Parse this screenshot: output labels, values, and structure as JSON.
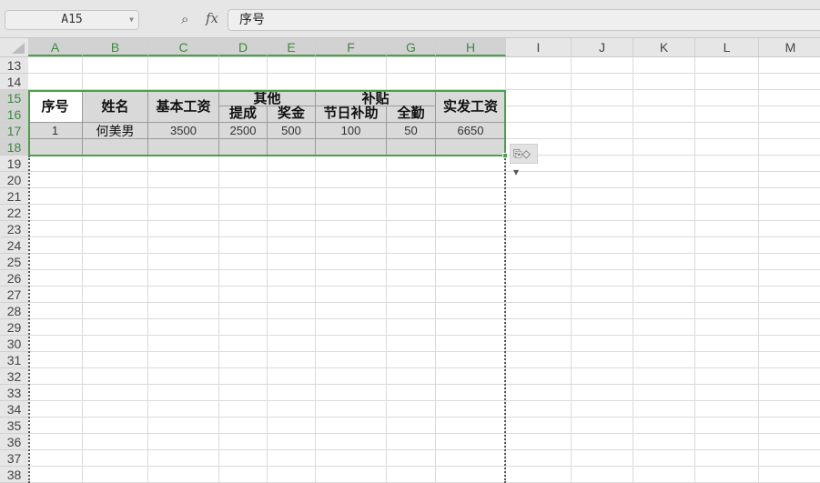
{
  "formula_bar": {
    "name_box": "A15",
    "formula": "序号",
    "fx_label": "fx"
  },
  "columns": [
    "A",
    "B",
    "C",
    "D",
    "E",
    "F",
    "G",
    "H",
    "I",
    "J",
    "K",
    "L",
    "M"
  ],
  "selected_columns": [
    "A",
    "B",
    "C",
    "D",
    "E",
    "F",
    "G",
    "H"
  ],
  "rows": [
    "13",
    "14",
    "15",
    "16",
    "17",
    "18",
    "19",
    "20",
    "21",
    "22",
    "23",
    "24",
    "25",
    "26",
    "27",
    "28",
    "29",
    "30",
    "31",
    "32",
    "33",
    "34",
    "35",
    "36",
    "37",
    "38"
  ],
  "selected_rows": [
    "15",
    "16",
    "17",
    "18"
  ],
  "table": {
    "h_seq": "序号",
    "h_name": "姓名",
    "h_base": "基本工资",
    "h_other": "其他",
    "h_commission": "提成",
    "h_bonus": "奖金",
    "h_allowance": "补贴",
    "h_holiday": "节日补助",
    "h_attendance": "全勤",
    "h_net": "实发工资",
    "row": {
      "seq": "1",
      "name": "何美男",
      "base": "3500",
      "commission": "2500",
      "bonus": "500",
      "holiday": "100",
      "attendance": "50",
      "net": "6650"
    }
  },
  "colors": {
    "selection": "#4aa14a",
    "header_bg": "#e6e6e6",
    "block_bg": "#d9d9d9"
  }
}
